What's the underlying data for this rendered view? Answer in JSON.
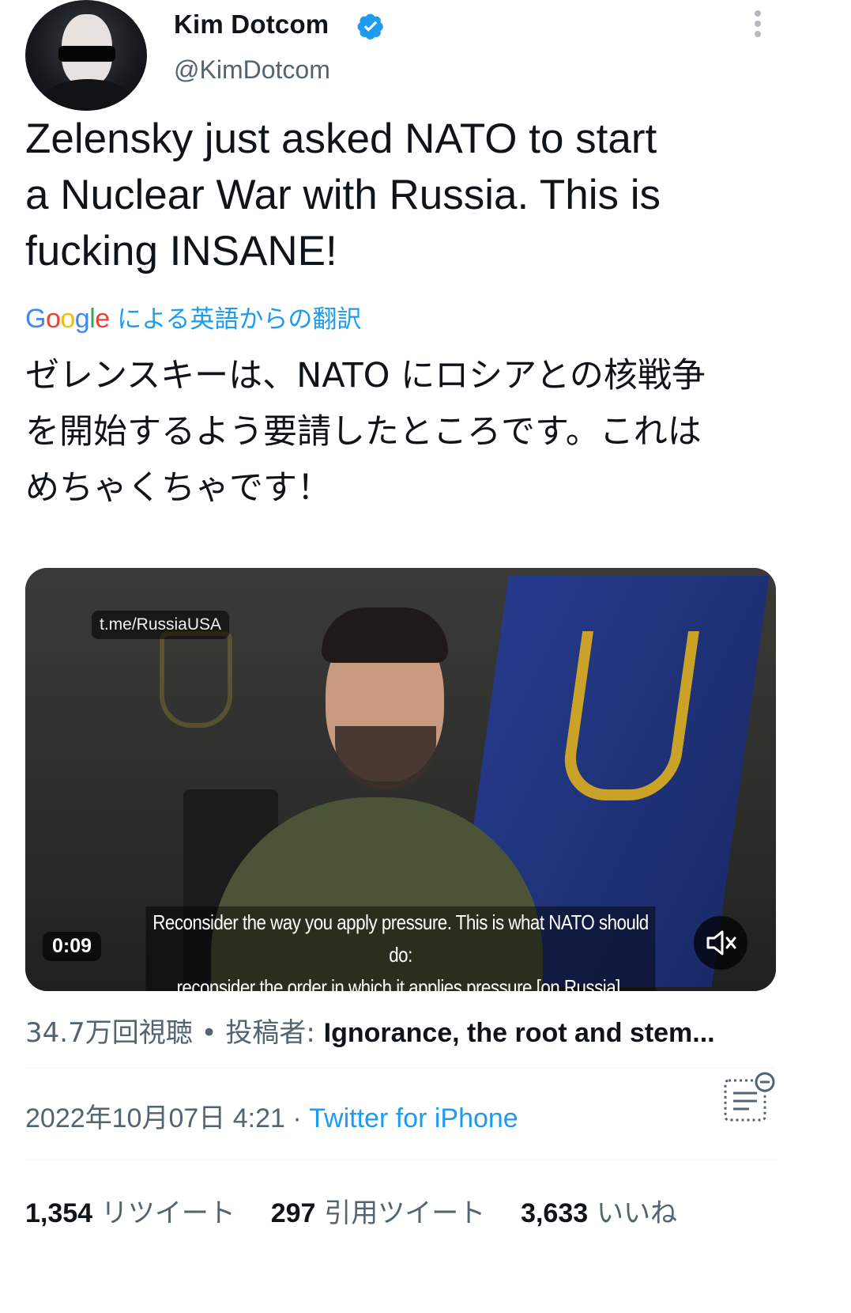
{
  "author": {
    "name": "Kim Dotcom",
    "handle": "@KimDotcom"
  },
  "tweet": {
    "text_lines": [
      "Zelensky just asked NATO to start",
      "a Nuclear War with Russia. This is",
      "fucking INSANE!"
    ],
    "translation_provider": "Google",
    "translation_label": "による英語からの翻訳",
    "translated_lines": [
      "ゼレンスキーは、NATO にロシアとの核戦争",
      "を開始するよう要請したところです。これは",
      "めちゃくちゃです！"
    ]
  },
  "video": {
    "watermark": "t.me/RussiaUSA",
    "subtitle_lines": [
      "Reconsider the way you apply pressure. This is what NATO should do:",
      "reconsider the order in which it applies pressure [on Russia]."
    ],
    "timer": "0:09"
  },
  "views": {
    "count": "34.7万回視聴",
    "dot": "•",
    "posted_by_label": "投稿者:",
    "posted_by": "Ignorance, the root and stem..."
  },
  "meta": {
    "timestamp": "2022年10月07日 4:21",
    "separator": "·",
    "client": "Twitter for iPhone"
  },
  "stats": {
    "retweets_count": "1,354",
    "retweets_label": "リツイート",
    "quotes_count": "297",
    "quotes_label": "引用ツイート",
    "likes_count": "3,633",
    "likes_label": "いいね"
  },
  "colors": {
    "link_blue": "#1d9bf0",
    "muted_text": "#536471",
    "primary_text": "#0f1419"
  },
  "icons": {
    "verified": "verified-badge-icon",
    "more": "more-vertical-icon",
    "mute": "speaker-muted-icon",
    "notes": "tweet-notes-icon"
  }
}
